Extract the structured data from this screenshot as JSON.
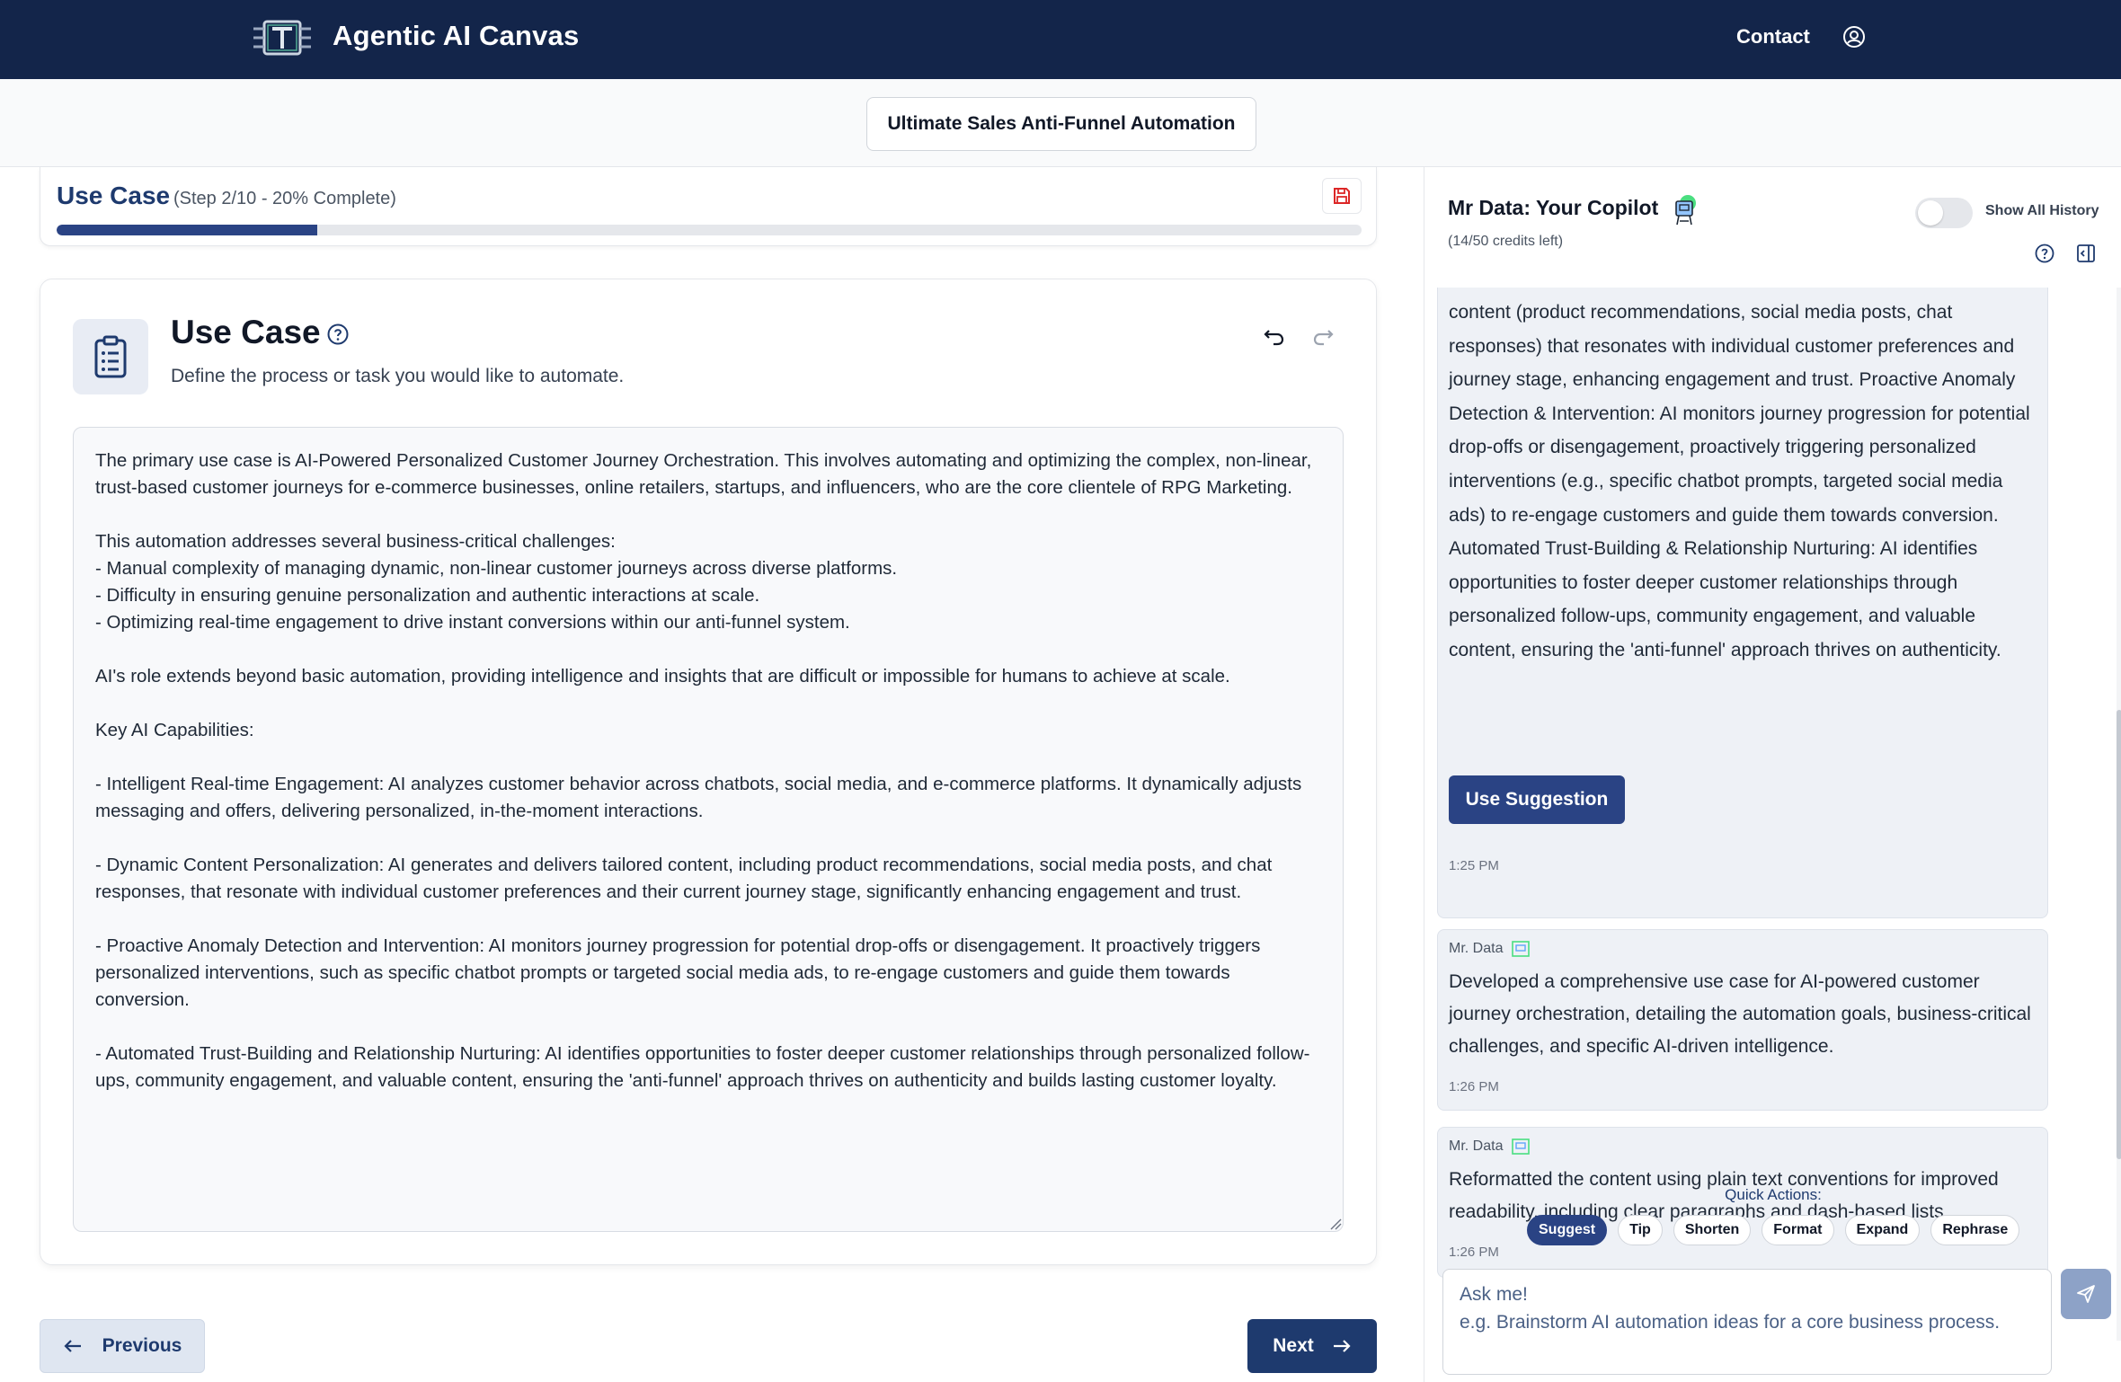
{
  "header": {
    "brand": "Agentic AI Canvas",
    "contact": "Contact",
    "logo_icon": "circuit-t-logo-icon",
    "user_icon": "user-circle-icon"
  },
  "project": {
    "name": "Ultimate Sales Anti-Funnel Automation"
  },
  "progress": {
    "title": "Use Case",
    "step_text": "(Step 2/10 - 20% Complete)",
    "percent": 20,
    "save_icon": "save-icon"
  },
  "card": {
    "title": "Use Case",
    "subtitle": "Define the process or task you would like to automate.",
    "icon": "clipboard-list-icon",
    "help_icon": "help-circle-icon",
    "undo_icon": "undo-icon",
    "redo_icon": "redo-icon",
    "editor_text": "The primary use case is AI-Powered Personalized Customer Journey Orchestration. This involves automating and optimizing the complex, non-linear, trust-based customer journeys for e-commerce businesses, online retailers, startups, and influencers, who are the core clientele of RPG Marketing.\n\nThis automation addresses several business-critical challenges:\n- Manual complexity of managing dynamic, non-linear customer journeys across diverse platforms.\n- Difficulty in ensuring genuine personalization and authentic interactions at scale.\n- Optimizing real-time engagement to drive instant conversions within our anti-funnel system.\n\nAI's role extends beyond basic automation, providing intelligence and insights that are difficult or impossible for humans to achieve at scale.\n\nKey AI Capabilities:\n\n- Intelligent Real-time Engagement: AI analyzes customer behavior across chatbots, social media, and e-commerce platforms. It dynamically adjusts messaging and offers, delivering personalized, in-the-moment interactions.\n\n- Dynamic Content Personalization: AI generates and delivers tailored content, including product recommendations, social media posts, and chat responses, that resonate with individual customer preferences and their current journey stage, significantly enhancing engagement and trust.\n\n- Proactive Anomaly Detection and Intervention: AI monitors journey progression for potential drop-offs or disengagement. It proactively triggers personalized interventions, such as specific chatbot prompts or targeted social media ads, to re-engage customers and guide them towards conversion.\n\n- Automated Trust-Building and Relationship Nurturing: AI identifies opportunities to foster deeper customer relationships through personalized follow-ups, community engagement, and valuable content, ensuring the 'anti-funnel' approach thrives on authenticity and builds lasting customer loyalty."
  },
  "nav": {
    "previous": "Previous",
    "next": "Next"
  },
  "copilot": {
    "title": "Mr Data: Your Copilot",
    "credits": "(14/50 credits left)",
    "history_label": "Show All History",
    "history_on": false,
    "messages": [
      {
        "text": "content (product recommendations, social media posts, chat responses) that resonates with individual customer preferences and journey stage, enhancing engagement and trust. Proactive Anomaly Detection & Intervention: AI monitors journey progression for potential drop-offs or disengagement, proactively triggering personalized interventions (e.g., specific chatbot prompts, targeted social media ads) to re-engage customers and guide them towards conversion. Automated Trust-Building & Relationship Nurturing: AI identifies opportunities to foster deeper customer relationships through personalized follow-ups, community engagement, and valuable content, ensuring the 'anti-funnel' approach thrives on authenticity.",
        "action": "Use Suggestion",
        "time": "1:25 PM"
      },
      {
        "author": "Mr. Data",
        "text": "Developed a comprehensive use case for AI-powered customer journey orchestration, detailing the automation goals, business-critical challenges, and specific AI-driven intelligence.",
        "time": "1:26 PM"
      },
      {
        "author": "Mr. Data",
        "text": "Reformatted the content using plain text conventions for improved readability, including clear paragraphs and dash-based lists.",
        "time": "1:26 PM"
      }
    ],
    "quick_actions_label": "Quick Actions:",
    "quick_actions": [
      "Suggest",
      "Tip",
      "Shorten",
      "Format",
      "Expand",
      "Rephrase"
    ],
    "input_placeholder": "Ask me!\ne.g. Brainstorm AI automation ideas for a core business process."
  },
  "colors": {
    "header_bg": "#13254a",
    "accent": "#2a4384",
    "progress_track": "#e5e7eb"
  }
}
